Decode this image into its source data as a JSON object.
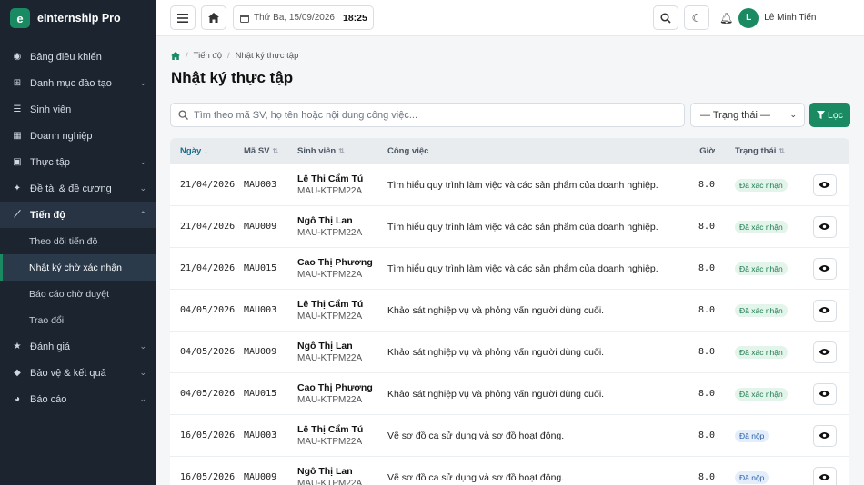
{
  "app": {
    "brand_letter": "e",
    "brand_name": "eInternship Pro"
  },
  "sidebar": {
    "items": [
      {
        "label": "Bảng điều khiển",
        "icon": "dashboard-icon",
        "chevron": false
      },
      {
        "label": "Danh mục đào tạo",
        "icon": "hierarchy-icon",
        "chevron": true
      },
      {
        "label": "Sinh viên",
        "icon": "students-icon",
        "chevron": false
      },
      {
        "label": "Doanh nghiệp",
        "icon": "building-icon",
        "chevron": false
      },
      {
        "label": "Thực tập",
        "icon": "briefcase-icon",
        "chevron": true
      },
      {
        "label": "Đề tài & đề cương",
        "icon": "lightbulb-icon",
        "chevron": true
      },
      {
        "label": "Tiến độ",
        "icon": "chart-line-icon",
        "chevron": true,
        "active": true
      }
    ],
    "sub_items": [
      {
        "label": "Theo dõi tiến độ"
      },
      {
        "label": "Nhật ký chờ xác nhận",
        "active": true
      },
      {
        "label": "Báo cáo chờ duyệt"
      },
      {
        "label": "Trao đổi"
      }
    ],
    "items_after": [
      {
        "label": "Đánh giá",
        "icon": "star-icon",
        "chevron": true
      },
      {
        "label": "Bảo vệ & kết quả",
        "icon": "graduation-cap-icon",
        "chevron": true
      },
      {
        "label": "Báo cáo",
        "icon": "pie-chart-icon",
        "chevron": true
      }
    ]
  },
  "topbar": {
    "date": "Thứ Ba, 15/09/2026",
    "time": "18:25",
    "user_name": "Lê Minh Tiến"
  },
  "breadcrumb": {
    "parent": "Tiến độ",
    "current": "Nhật ký thực tập"
  },
  "page_title": "Nhật ký thực tập",
  "search": {
    "placeholder": "Tìm theo mã SV, họ tên hoặc nội dung công việc..."
  },
  "status_select": {
    "value": "— Trạng thái —"
  },
  "filter_button": {
    "label": "Lọc"
  },
  "table": {
    "columns": {
      "date": "Ngày",
      "code": "Mã SV",
      "student": "Sinh viên",
      "task": "Công việc",
      "hours": "Giờ",
      "status": "Trạng thái"
    },
    "rows": [
      {
        "date": "21/04/2026",
        "code": "MAU003",
        "name": "Lê Thị Cẩm Tú",
        "class": "MAU-KTPM22A",
        "task": "Tìm hiểu quy trình làm việc và các sản phẩm của doanh nghiệp.",
        "hours": "8.0",
        "status": "Đã xác nhận",
        "status_kind": "ok"
      },
      {
        "date": "21/04/2026",
        "code": "MAU009",
        "name": "Ngô Thị Lan",
        "class": "MAU-KTPM22A",
        "task": "Tìm hiểu quy trình làm việc và các sản phẩm của doanh nghiệp.",
        "hours": "8.0",
        "status": "Đã xác nhận",
        "status_kind": "ok"
      },
      {
        "date": "21/04/2026",
        "code": "MAU015",
        "name": "Cao Thị Phương",
        "class": "MAU-KTPM22A",
        "task": "Tìm hiểu quy trình làm việc và các sản phẩm của doanh nghiệp.",
        "hours": "8.0",
        "status": "Đã xác nhận",
        "status_kind": "ok"
      },
      {
        "date": "04/05/2026",
        "code": "MAU003",
        "name": "Lê Thị Cẩm Tú",
        "class": "MAU-KTPM22A",
        "task": "Khảo sát nghiệp vụ và phỏng vấn người dùng cuối.",
        "hours": "8.0",
        "status": "Đã xác nhận",
        "status_kind": "ok"
      },
      {
        "date": "04/05/2026",
        "code": "MAU009",
        "name": "Ngô Thị Lan",
        "class": "MAU-KTPM22A",
        "task": "Khảo sát nghiệp vụ và phỏng vấn người dùng cuối.",
        "hours": "8.0",
        "status": "Đã xác nhận",
        "status_kind": "ok"
      },
      {
        "date": "04/05/2026",
        "code": "MAU015",
        "name": "Cao Thị Phương",
        "class": "MAU-KTPM22A",
        "task": "Khảo sát nghiệp vụ và phỏng vấn người dùng cuối.",
        "hours": "8.0",
        "status": "Đã xác nhận",
        "status_kind": "ok"
      },
      {
        "date": "16/05/2026",
        "code": "MAU003",
        "name": "Lê Thị Cẩm Tú",
        "class": "MAU-KTPM22A",
        "task": "Vẽ sơ đồ ca sử dụng và sơ đồ hoạt động.",
        "hours": "8.0",
        "status": "Đã nộp",
        "status_kind": "sub"
      },
      {
        "date": "16/05/2026",
        "code": "MAU009",
        "name": "Ngô Thị Lan",
        "class": "MAU-KTPM22A",
        "task": "Vẽ sơ đồ ca sử dụng và sơ đồ hoạt động.",
        "hours": "8.0",
        "status": "Đã nộp",
        "status_kind": "sub"
      }
    ]
  }
}
